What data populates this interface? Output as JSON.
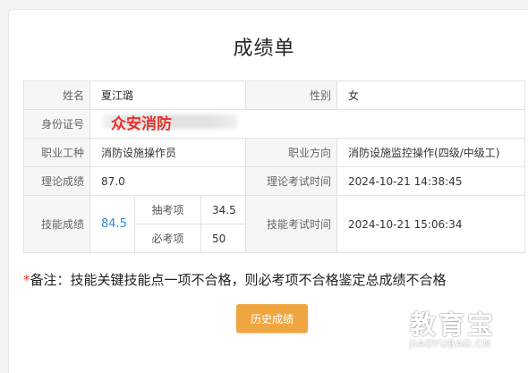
{
  "page": {
    "title": "成绩单"
  },
  "table": {
    "name_label": "姓名",
    "name_value": "夏江璐",
    "gender_label": "性别",
    "gender_value": "女",
    "id_label": "身份证号",
    "id_overlay": "众安消防",
    "occupation_label": "职业工种",
    "occupation_value": "消防设施操作员",
    "direction_label": "职业方向",
    "direction_value": "消防设施监控操作(四级/中级工)",
    "theory_score_label": "理论成绩",
    "theory_score_value": "87.0",
    "theory_time_label": "理论考试时间",
    "theory_time_value": "2024-10-21 14:38:45",
    "skill_score_label": "技能成绩",
    "skill_score_value": "84.5",
    "sample_item_label": "抽考项",
    "sample_item_value": "34.5",
    "required_item_label": "必考项",
    "required_item_value": "50",
    "skill_time_label": "技能考试时间",
    "skill_time_value": "2024-10-21 15:06:34"
  },
  "note": {
    "star": "*",
    "text": "备注：技能关键技能点一项不合格，则必考项不合格鉴定总成绩不合格"
  },
  "button": {
    "history_label": "历史成绩"
  },
  "watermark": {
    "main": "教育宝",
    "sub": "JIAOYUBAO.CN"
  },
  "colors": {
    "accent_button": "#f0a640",
    "score_link": "#3a8ad6",
    "required_star": "#e8332d"
  }
}
